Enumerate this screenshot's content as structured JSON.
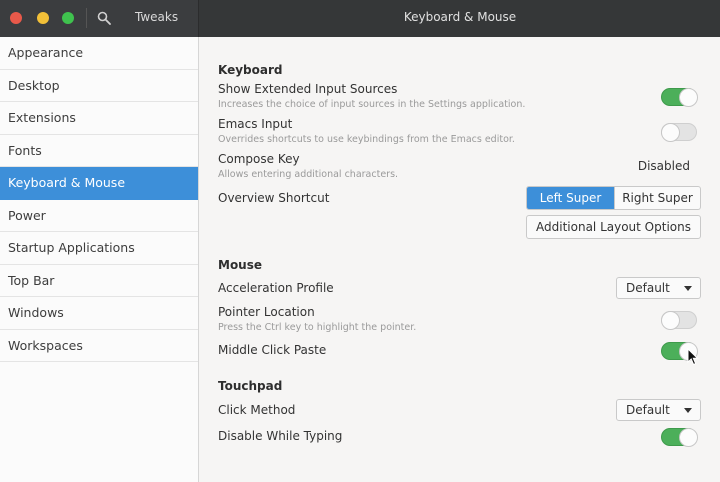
{
  "titlebar": {
    "app_title": "Tweaks",
    "page_title": "Keyboard & Mouse"
  },
  "sidebar": {
    "items": [
      {
        "label": "Appearance"
      },
      {
        "label": "Desktop"
      },
      {
        "label": "Extensions"
      },
      {
        "label": "Fonts"
      },
      {
        "label": "Keyboard & Mouse",
        "selected": true
      },
      {
        "label": "Power"
      },
      {
        "label": "Startup Applications"
      },
      {
        "label": "Top Bar"
      },
      {
        "label": "Windows"
      },
      {
        "label": "Workspaces"
      }
    ]
  },
  "keyboard": {
    "section_title": "Keyboard",
    "extended_input": {
      "label": "Show Extended Input Sources",
      "description": "Increases the choice of input sources in the Settings application.",
      "enabled": true
    },
    "emacs_input": {
      "label": "Emacs Input",
      "description": "Overrides shortcuts to use keybindings from the Emacs editor.",
      "enabled": false
    },
    "compose_key": {
      "label": "Compose Key",
      "description": "Allows entering additional characters.",
      "value": "Disabled"
    },
    "overview_shortcut": {
      "label": "Overview Shortcut",
      "options": [
        "Left Super",
        "Right Super"
      ],
      "selected": "Left Super"
    },
    "additional_layout_button": "Additional Layout Options"
  },
  "mouse": {
    "section_title": "Mouse",
    "acceleration_profile": {
      "label": "Acceleration Profile",
      "value": "Default"
    },
    "pointer_location": {
      "label": "Pointer Location",
      "description": "Press the Ctrl key to highlight the pointer.",
      "enabled": false
    },
    "middle_click_paste": {
      "label": "Middle Click Paste",
      "enabled": true
    }
  },
  "touchpad": {
    "section_title": "Touchpad",
    "click_method": {
      "label": "Click Method",
      "value": "Default"
    },
    "disable_while_typing": {
      "label": "Disable While Typing",
      "enabled": true
    }
  },
  "colors": {
    "accent": "#3d8fd9",
    "switch_on": "#4caf5a",
    "titlebar": "#353738"
  }
}
